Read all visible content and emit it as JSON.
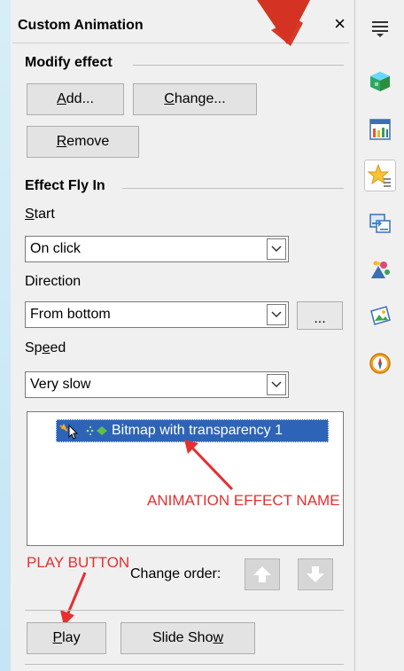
{
  "panel": {
    "title": "Custom Animation",
    "close_glyph": "×",
    "modify_section": "Modify effect",
    "add_label": [
      "",
      "A",
      "dd..."
    ],
    "change_label": [
      "",
      "C",
      "hange..."
    ],
    "remove_label": [
      "",
      "R",
      "emove"
    ],
    "effect_section": "Effect Fly In",
    "start_label": [
      "",
      "S",
      "tart"
    ],
    "start_value": "On click",
    "direction_label": "Direction",
    "direction_value": "From bottom",
    "ellipsis_label": "...",
    "speed_label": [
      "Sp",
      "e",
      "ed"
    ],
    "speed_value": "Very slow",
    "effect_items": [
      "Bitmap with transparency 1"
    ],
    "change_order_label": "Change order:",
    "play_label": [
      "",
      "P",
      "lay"
    ],
    "slideshow_label": [
      "Slide Sho",
      "w",
      ""
    ]
  },
  "annotations": {
    "effect_name": "ANIMATION EFFECT NAME",
    "play_button": "PLAY BUTTON"
  },
  "side_icons": [
    "properties-icon",
    "styles-icon",
    "gallery-icon",
    "custom-animation-icon",
    "slide-transition-icon",
    "master-slides-icon",
    "gallery-image-icon",
    "navigator-icon"
  ],
  "colors": {
    "selection": "#2e64b7",
    "annotation": "#e43030"
  }
}
